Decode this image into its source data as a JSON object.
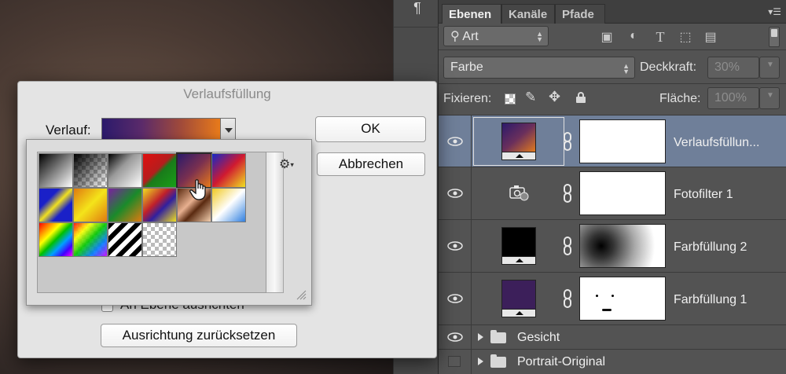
{
  "panel": {
    "tabs": [
      {
        "label": "Ebenen",
        "active": true
      },
      {
        "label": "Kanäle",
        "active": false
      },
      {
        "label": "Pfade",
        "active": false
      }
    ],
    "filter_kind": "Art",
    "filter_icons": [
      "image-filter-icon",
      "adjustment-filter-icon",
      "type-filter-icon",
      "shape-filter-icon",
      "smart-object-filter-icon"
    ],
    "blend_mode": "Farbe",
    "opacity_label": "Deckkraft:",
    "opacity_value": "30%",
    "lock_label": "Fixieren:",
    "fill_label": "Fläche:",
    "fill_value": "100%"
  },
  "layers": [
    {
      "name": "Verlaufsfüllun...",
      "selected": true
    },
    {
      "name": "Fotofilter 1",
      "selected": false
    },
    {
      "name": "Farbfüllung 2",
      "selected": false
    },
    {
      "name": "Farbfüllung 1",
      "selected": false
    }
  ],
  "groups": [
    {
      "name": "Gesicht",
      "visible": true
    },
    {
      "name": "Portrait-Original",
      "visible": false
    }
  ],
  "dialog": {
    "title": "Verlaufsfüllung",
    "gradient_label": "Verlauf:",
    "ok_label": "OK",
    "cancel_label": "Abbrechen",
    "align_label": "An Ebene ausrichten",
    "reset_align_label": "Ausrichtung zurücksetzen"
  },
  "colors": {
    "accent_selected_row": "#6f7f99",
    "panel_bg": "#535353",
    "dialog_bg": "#e4e4e4",
    "solid_fill_1": "#3c1f5a",
    "solid_fill_2": "#000000"
  }
}
